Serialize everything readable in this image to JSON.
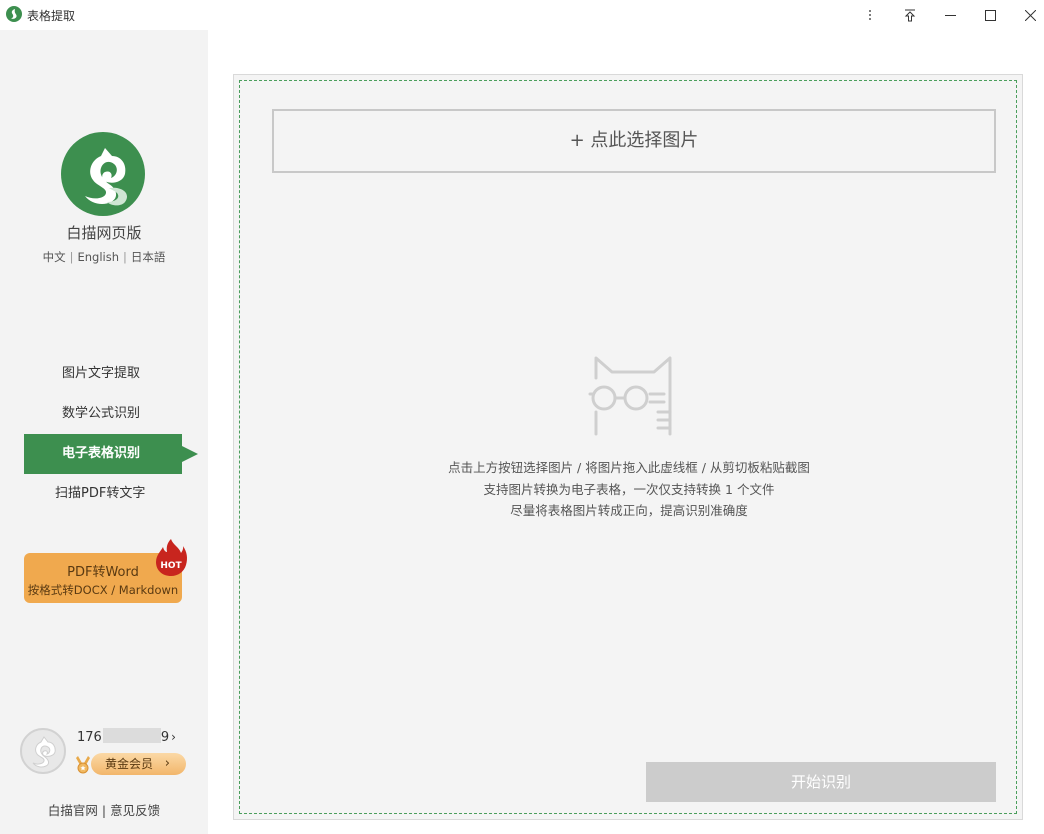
{
  "window": {
    "title": "表格提取",
    "controls": [
      "more-icon",
      "pin-icon",
      "minimize-icon",
      "maximize-icon",
      "close-icon"
    ]
  },
  "sidebar": {
    "brand_name": "白描网页版",
    "languages": [
      "中文",
      "English",
      "日本語"
    ],
    "nav_items": [
      {
        "label": "图片文字提取",
        "active": false
      },
      {
        "label": "数学公式识别",
        "active": false
      },
      {
        "label": "电子表格识别",
        "active": true
      },
      {
        "label": "扫描PDF转文字",
        "active": false
      }
    ],
    "promo": {
      "title": "PDF转Word",
      "subtitle": "按格式转DOCX / Markdown",
      "badge": "HOT"
    },
    "user": {
      "phone_prefix": "176",
      "phone_suffix": "9",
      "membership": "黄金会员"
    },
    "footer": {
      "official_site": "白描官网",
      "separator": "|",
      "feedback": "意见反馈"
    }
  },
  "main": {
    "select_button": "+ 点此选择图片",
    "hints": [
      "点击上方按钮选择图片 / 将图片拖入此虚线框 / 从剪切板粘贴截图",
      "支持图片转换为电子表格，一次仅支持转换 1 个文件",
      "尽量将表格图片转成正向，提高识别准确度"
    ],
    "start_button": "开始识别"
  },
  "colors": {
    "brand_green": "#3d8f4f",
    "promo_orange": "#f0a94e",
    "hot_red": "#c8251e",
    "disabled_gray": "#cccccc"
  }
}
